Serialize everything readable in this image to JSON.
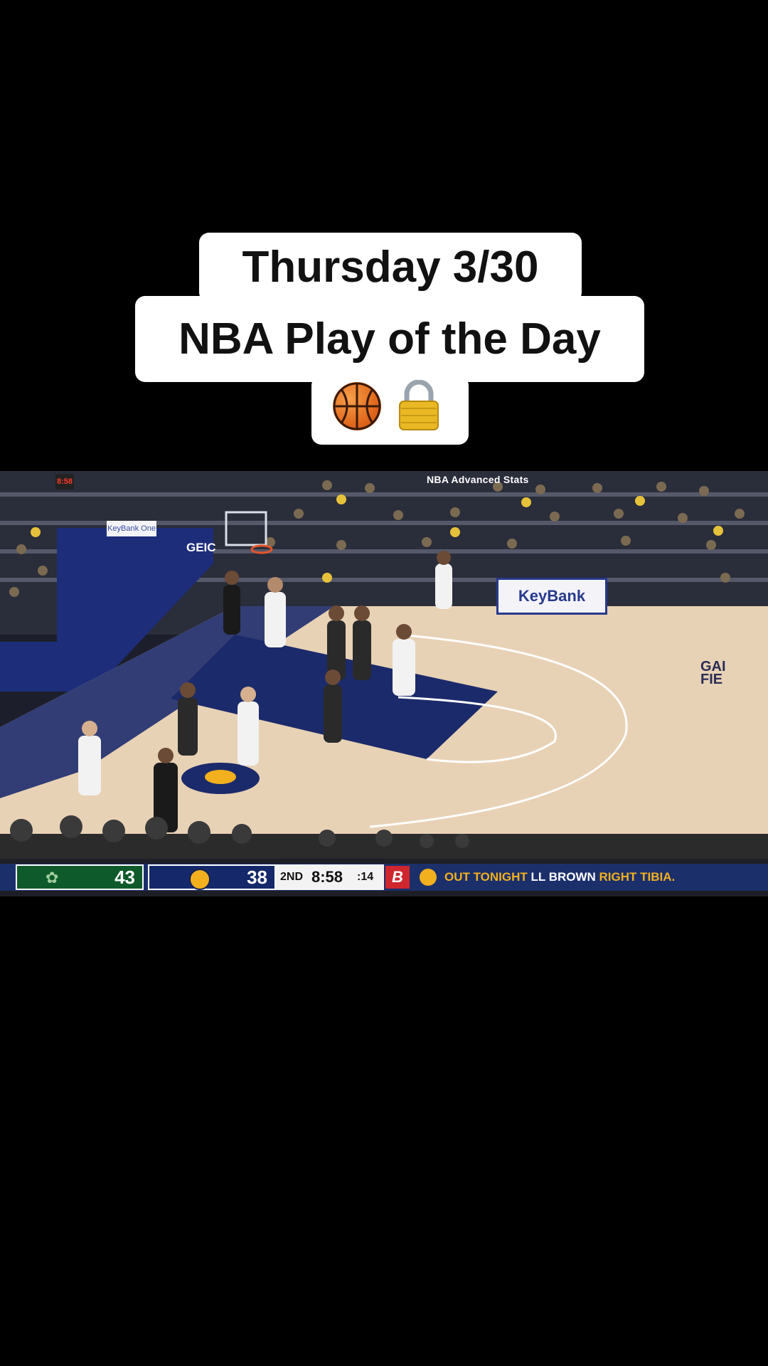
{
  "caption": {
    "line1": "Thursday 3/30",
    "line2": "NBA Play of the Day",
    "emojis": [
      "basketball-emoji",
      "locked-padlock-emoji"
    ]
  },
  "video": {
    "overlay_label": "NBA Advanced Stats",
    "shot_clock_display": "8:58",
    "sponsor_sign": "KeyBank",
    "sponsor_sign_small": "KeyBank One",
    "geico_sign": "GEIC",
    "court_text": "GAI\nFIE"
  },
  "scorebug": {
    "team1_score": "43",
    "team2_score": "38",
    "period": "2ND",
    "game_clock": "8:58",
    "shot_clock": ":14",
    "ticker_highlight_1": "OUT TONIGHT",
    "ticker_text_1": " LL BROWN ",
    "ticker_highlight_2": "RIGHT TIBIA.",
    "colors": {
      "bucks_green": "#0f5a2a",
      "pacers_navy": "#15296a",
      "pacers_gold": "#f2b01e",
      "ticker_bg": "#1b2f6b"
    }
  }
}
